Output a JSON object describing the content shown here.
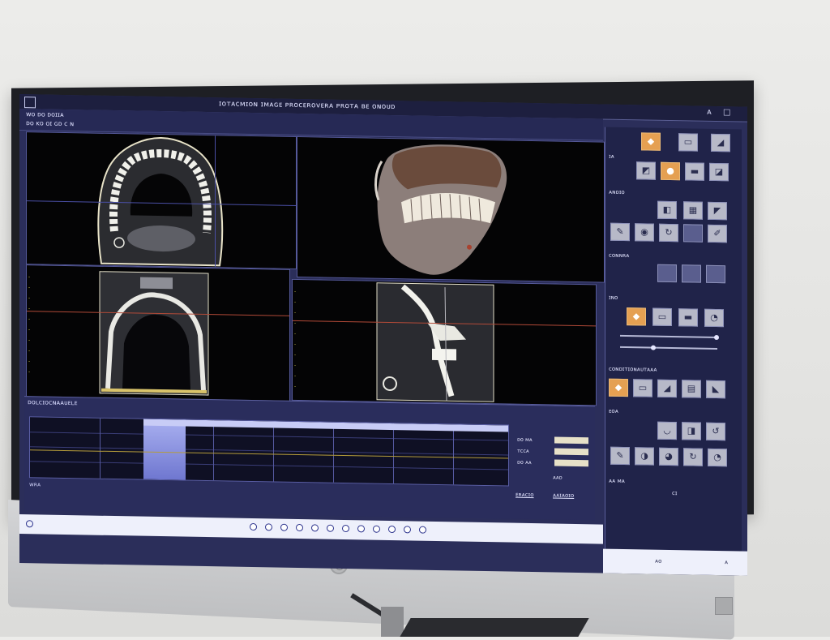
{
  "window": {
    "title": "ɪᴏᴛᴀᴄᴍɪᴏɴ ɪᴍᴀɢᴇ ᴘʀᴏᴄᴇʀᴏᴠᴇʀᴀ ᴘʀᴏᴛᴀ ʙᴇ ᴏɴᴏᴜᴅ",
    "controls": [
      "ᴀ",
      "□"
    ]
  },
  "header": {
    "study_label": "ᴡᴏ ᴅᴏ ᴅᴏɪɪᴀ",
    "series_label": "ᴅᴏ ᴋᴏ ᴏɪ ɢᴅ ᴄ ɴ"
  },
  "viewports": {
    "top_left": "",
    "top_right": "",
    "bottom_left": "",
    "bottom_right": ""
  },
  "timeline": {
    "title": "ᴅᴏʟᴄɪᴏᴄɴᴀᴀᴜᴇʟᴇ",
    "footer": "ᴡʀᴀ",
    "info_rows": [
      "ᴅᴏ ᴍᴀ",
      "ᴛᴄᴄᴀ",
      "ᴅᴏ ᴀᴀ"
    ],
    "info_link": "ᴀᴀᴅ",
    "link_left": "ᴇʀᴀᴄɪᴏ",
    "link_right": "ᴀᴀɪᴀᴏɪᴏ"
  },
  "toolpanel": {
    "section_1": "ɪᴀ",
    "section_2": "ᴀɴᴅɪᴏ",
    "section_3": "ᴄᴏɴɴʀᴀ",
    "section_4": "ɪɴᴏ",
    "section_5": "ᴄᴏɴᴅɪᴛɪᴏɴᴀᴜᴛᴀᴀᴀ",
    "section_6": "ᴇᴏᴀ",
    "footer_left": "ᴀᴀ ᴍᴀ",
    "footer_right": "ᴄɪ",
    "status_text": "ᴀᴏ",
    "status_badge": "ᴀ"
  },
  "colors": {
    "accent": "#e5a052",
    "panel": "#2b2e5a",
    "viewport_bg": "#040405",
    "grid_line": "#4a4fa5",
    "reference_line": "#b24a38"
  },
  "icons": [
    "app-logo-icon",
    "minimize-icon",
    "maximize-icon",
    "tooth-icon",
    "cube-icon",
    "layers-icon",
    "brush-icon",
    "measure-icon",
    "crop-icon",
    "pen-icon",
    "rotate-icon",
    "zoom-icon",
    "contrast-icon"
  ]
}
